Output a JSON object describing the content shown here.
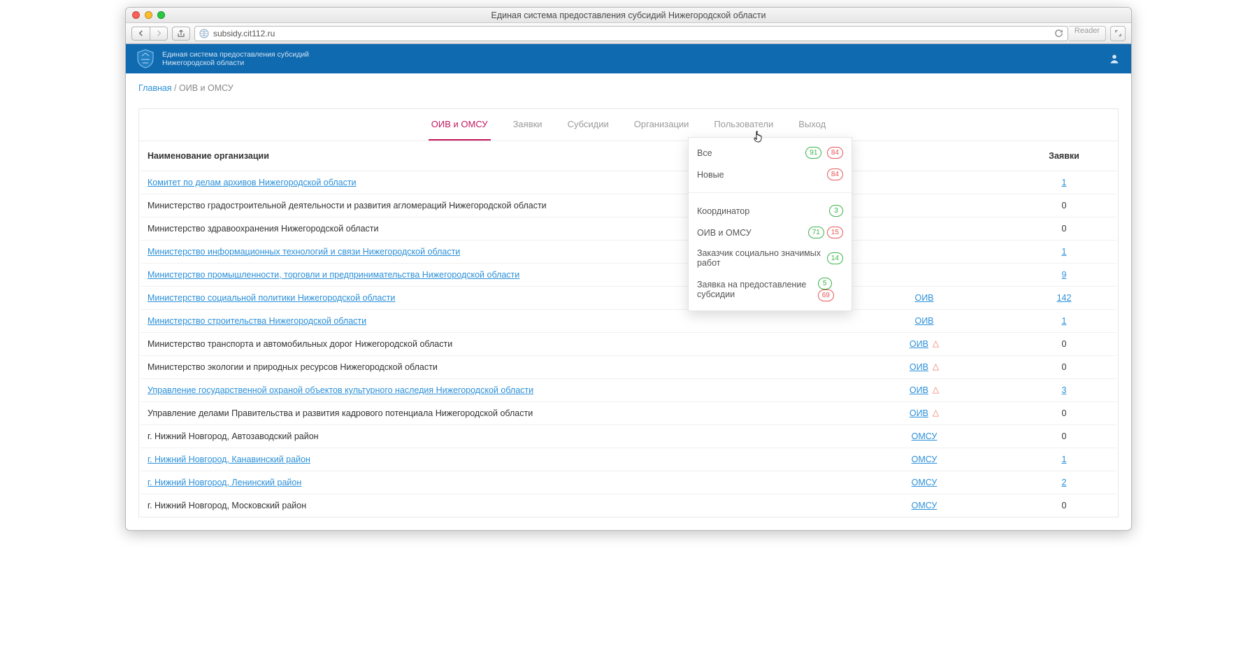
{
  "mac": {
    "title": "Единая система предоставления субсидий Нижегородской области",
    "url": "subsidy.cit112.ru",
    "reader": "Reader"
  },
  "header": {
    "line1": "Единая система предоставления субсидий",
    "line2": "Нижегородской области"
  },
  "breadcrumb": {
    "home": "Главная",
    "sep": " / ",
    "current": "ОИВ и ОМСУ"
  },
  "tabs": [
    "ОИВ и ОМСУ",
    "Заявки",
    "Субсидии",
    "Организации",
    "Пользователи",
    "Выход"
  ],
  "dropdown": {
    "all": "Все",
    "all_badges": [
      "91",
      "84"
    ],
    "new": "Новые",
    "new_badges": [
      "84"
    ],
    "items": [
      {
        "label": "Координатор",
        "badges": [
          {
            "v": "3",
            "c": "green"
          }
        ]
      },
      {
        "label": "ОИВ и ОМСУ",
        "badges": [
          {
            "v": "71",
            "c": "green"
          },
          {
            "v": "15",
            "c": "red"
          }
        ]
      },
      {
        "label": "Заказчик социально значимых работ",
        "badges": [
          {
            "v": "14",
            "c": "green"
          }
        ]
      },
      {
        "label": "Заявка на предоставление субсидии",
        "badges": [
          {
            "v": "5",
            "c": "green"
          },
          {
            "v": "69",
            "c": "red"
          }
        ]
      }
    ]
  },
  "table": {
    "headers": {
      "name": "Наименование организации",
      "type": "",
      "apps": "Заявки"
    },
    "rows": [
      {
        "name": "Комитет по делам архивов Нижегородской области",
        "link": true,
        "type": "",
        "warn": false,
        "apps": "1",
        "apps_link": true
      },
      {
        "name": "Министерство градостроительной деятельности и развития агломераций Нижегородской области",
        "link": false,
        "type": "",
        "warn": false,
        "apps": "0",
        "apps_link": false
      },
      {
        "name": "Министерство здравоохранения Нижегородской области",
        "link": false,
        "type": "",
        "warn": false,
        "apps": "0",
        "apps_link": false
      },
      {
        "name": "Министерство информационных технологий и связи Нижегородской области",
        "link": true,
        "type": "",
        "warn": false,
        "apps": "1",
        "apps_link": true
      },
      {
        "name": "Министерство промышленности, торговли и предпринимательства Нижегородской области",
        "link": true,
        "type": "",
        "warn": false,
        "apps": "9",
        "apps_link": true
      },
      {
        "name": "Министерство социальной политики Нижегородской области",
        "link": true,
        "type": "ОИВ",
        "warn": false,
        "apps": "142",
        "apps_link": true
      },
      {
        "name": "Министерство строительства Нижегородской области",
        "link": true,
        "type": "ОИВ",
        "warn": false,
        "apps": "1",
        "apps_link": true
      },
      {
        "name": "Министерство транспорта и автомобильных дорог Нижегородской области",
        "link": false,
        "type": "ОИВ",
        "warn": true,
        "apps": "0",
        "apps_link": false
      },
      {
        "name": "Министерство экологии и природных ресурсов Нижегородской области",
        "link": false,
        "type": "ОИВ",
        "warn": true,
        "apps": "0",
        "apps_link": false
      },
      {
        "name": "Управление государственной охраной объектов культурного наследия Нижегородской области",
        "link": true,
        "type": "ОИВ",
        "warn": true,
        "apps": "3",
        "apps_link": true
      },
      {
        "name": "Управление делами Правительства и развития кадрового потенциала Нижегородской области",
        "link": false,
        "type": "ОИВ",
        "warn": true,
        "apps": "0",
        "apps_link": false
      },
      {
        "name": "г. Нижний Новгород, Автозаводский район",
        "link": false,
        "type": "ОМСУ",
        "warn": false,
        "apps": "0",
        "apps_link": false
      },
      {
        "name": "г. Нижний Новгород, Канавинский район",
        "link": true,
        "type": "ОМСУ",
        "warn": false,
        "apps": "1",
        "apps_link": true
      },
      {
        "name": "г. Нижний Новгород, Ленинский район",
        "link": true,
        "type": "ОМСУ",
        "warn": false,
        "apps": "2",
        "apps_link": true
      },
      {
        "name": "г. Нижний Новгород, Московский район",
        "link": false,
        "type": "ОМСУ",
        "warn": false,
        "apps": "0",
        "apps_link": false
      }
    ]
  }
}
